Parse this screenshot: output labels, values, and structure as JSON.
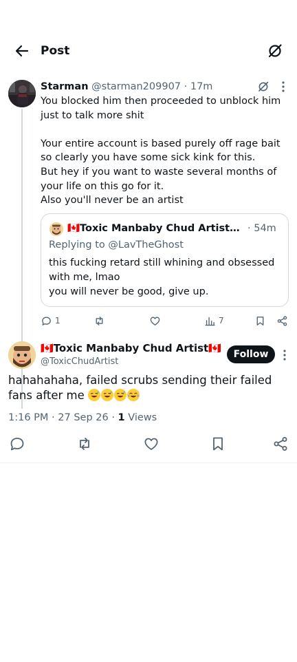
{
  "header": {
    "title": "Post"
  },
  "reply": {
    "name": "Starman",
    "handle": "@starman209907",
    "separator": "·",
    "time": "17m",
    "body": "You blocked him then proceeded to unblock him just to talk more shit\n\nYour entire account is based purely off rage bait so clearly you have some sick kink for this.\nBut hey if you want to waste several months of your life on this go for it.\nAlso you'll never be an artist",
    "quote": {
      "name": "🇨🇦Toxic Manbaby Chud Artist🇨🇦 ...",
      "time": "· 54m",
      "replying_prefix": "Replying to",
      "replying_handle": "@LavTheGhost",
      "body": "this fucking retard still whining and obsessed with me, lmao\nyou will never be good, give up."
    },
    "actions": {
      "replies": "1",
      "views": "7"
    }
  },
  "main_post": {
    "name": "🇨🇦Toxic Manbaby Chud Artist🇨🇦",
    "handle": "@ToxicChudArtist",
    "follow_label": "Follow",
    "text": "hahahahaha, failed scrubs sending their failed fans after me",
    "time": "1:16 PM",
    "date": "27 Sep 26",
    "views_count": "1",
    "views_label": "Views",
    "dot": "·"
  },
  "colors": {
    "text": "#0f1419",
    "secondary": "#536471",
    "border": "#cfd9de",
    "button": "#0f1419"
  },
  "icons": {
    "back": "arrow-left-icon",
    "grok": "grok-icon",
    "more": "more-vertical-icon",
    "reply": "reply-icon",
    "repost": "repost-icon",
    "like": "heart-icon",
    "views": "views-icon",
    "bookmark": "bookmark-icon",
    "share": "share-icon"
  }
}
